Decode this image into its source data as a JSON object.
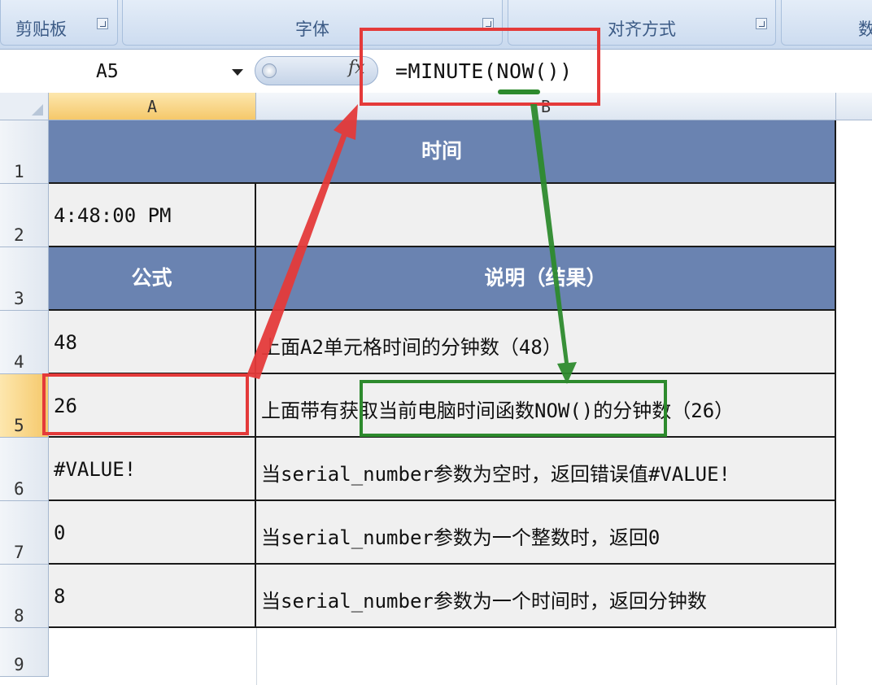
{
  "ribbon": {
    "groups": [
      "剪贴板",
      "字体",
      "对齐方式",
      "数"
    ]
  },
  "formula_bar": {
    "name_box": "A5",
    "fx_icon": "fx-icon",
    "formula": "=MINUTE(NOW())"
  },
  "columns": [
    "A",
    "B"
  ],
  "rows": [
    "1",
    "2",
    "3",
    "4",
    "5",
    "6",
    "7",
    "8",
    "9"
  ],
  "sheet": {
    "title": "时间",
    "time_value": "4:48:00 PM",
    "header_formula": "公式",
    "header_desc": "说明（结果）",
    "data": [
      {
        "result": "48",
        "desc": "上面A2单元格时间的分钟数（48）"
      },
      {
        "result": "26",
        "desc": "上面带有获取当前电脑时间函数NOW()的分钟数（26）"
      },
      {
        "result": "#VALUE!",
        "desc": "当serial_number参数为空时，返回错误值#VALUE!"
      },
      {
        "result": "0",
        "desc": "当serial_number参数为一个整数时，返回0"
      },
      {
        "result": "8",
        "desc": "当serial_number参数为一个时间时，返回分钟数"
      }
    ]
  },
  "colors": {
    "header_fill": "#6a83b1",
    "annotation_red": "#e43a3a",
    "annotation_green": "#2d8a2d",
    "selection": "#f5c86a"
  }
}
